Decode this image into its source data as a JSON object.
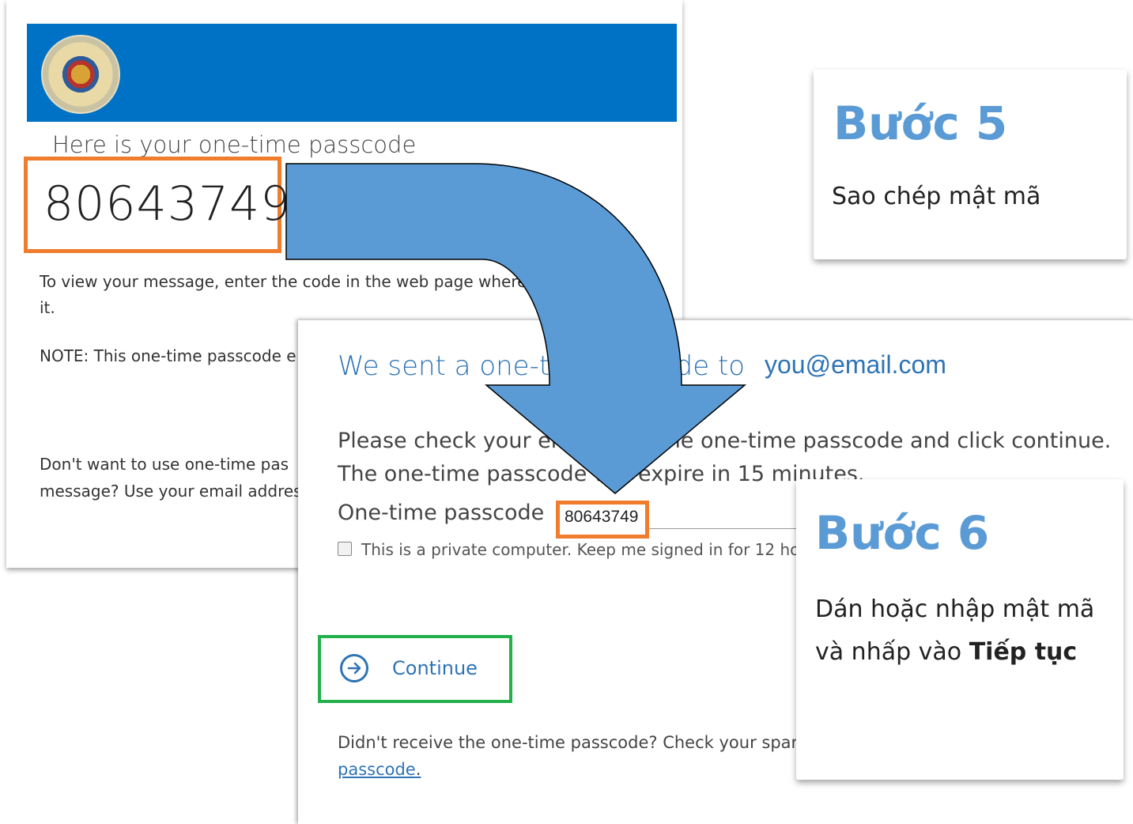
{
  "email": {
    "heading": "Here is your one-time passcode",
    "code": "80643749",
    "body1": "To view your message, enter the code in the web page where it.",
    "body1_line1": "To view your message, enter the code in the web page where",
    "body1_line2": "it.",
    "note": "NOTE: This one-time passcode e",
    "body2_line1": "Don't want to use one-time pas",
    "body2_line2": "message? Use your email addres"
  },
  "form": {
    "title": "We sent a one-ti",
    "title_tail": "de to",
    "email": "you@email.com",
    "desc_line1": "Please check your em",
    "desc_line1_tail": "the one-time passcode and click continue.",
    "desc_line2": "The one-time passcode w",
    "desc_line2_tail": "l expire in 15 minutes.",
    "passcode_label": "One-time passcode",
    "passcode_value": "80643749",
    "checkbox_label": "This is a private computer. Keep me signed in for 12 hours",
    "continue_label": "Continue",
    "resend_text": "Didn't receive the one-time passcode? Check your spar",
    "resend_link": "passcode",
    "resend_link_tail": "."
  },
  "steps": {
    "step5": {
      "title": "Bước 5",
      "text": "Sao chép mật mã"
    },
    "step6": {
      "title": "Bước 6",
      "text_before": "Dán hoặc nhập mật mã và nhấp vào ",
      "text_bold": "Tiếp tục"
    }
  },
  "colors": {
    "banner": "#0072c6",
    "highlight_orange": "#ef7d2d",
    "highlight_green": "#22b04b",
    "step_title": "#5b9bd5",
    "arrow_fill": "#5b9bd5"
  },
  "icons": {
    "seal": "seal-icon",
    "continue": "arrow-right-circle-icon"
  }
}
